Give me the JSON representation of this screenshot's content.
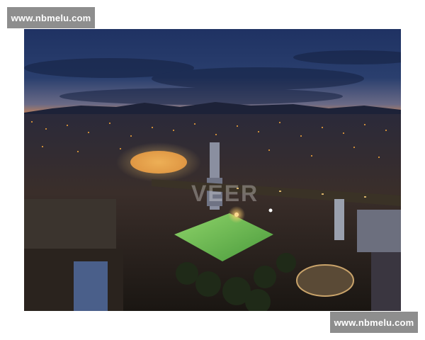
{
  "watermarks": {
    "top_badge": "www.nbmelu.com",
    "bottom_badge": "www.nbmelu.com",
    "photo_overlay": "VEER"
  },
  "colors": {
    "badge_bg": "#8e8e8e",
    "badge_text": "#ffffff",
    "sky_top": "#1c2a4d",
    "horizon_glow": "#e0894a",
    "pitch": "#5fb54c",
    "city_lights": "#f2a43a"
  },
  "photo": {
    "subject": "aerial-night-city-view"
  }
}
